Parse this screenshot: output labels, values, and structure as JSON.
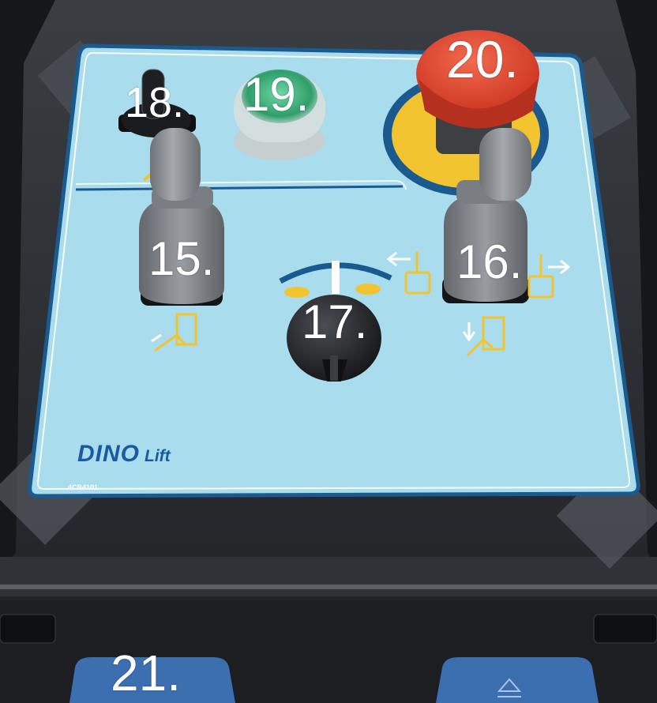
{
  "callouts": {
    "c18": "18.",
    "c19": "19.",
    "c20": "20.",
    "c15": "15.",
    "c16": "16.",
    "c17": "17.",
    "c21": "21."
  },
  "decal": {
    "brand_main": "DINO",
    "brand_sub": "Lift",
    "part_number": "4CB4101"
  },
  "colors": {
    "decal": "#a9dcec",
    "decal_border": "#1b5a8f",
    "emergency_stop": "#e5432c",
    "emergency_ring": "#f2c430",
    "green_lamp": "#34b67e",
    "joystick": "#8a8d92",
    "housing": "#2a2d31"
  },
  "icons": [
    "toggle-switch-icon",
    "indicator-lamp-icon",
    "emergency-stop-icon",
    "joystick-icon",
    "rotary-selector-icon",
    "lift-direction-icon",
    "arrow-icon"
  ]
}
